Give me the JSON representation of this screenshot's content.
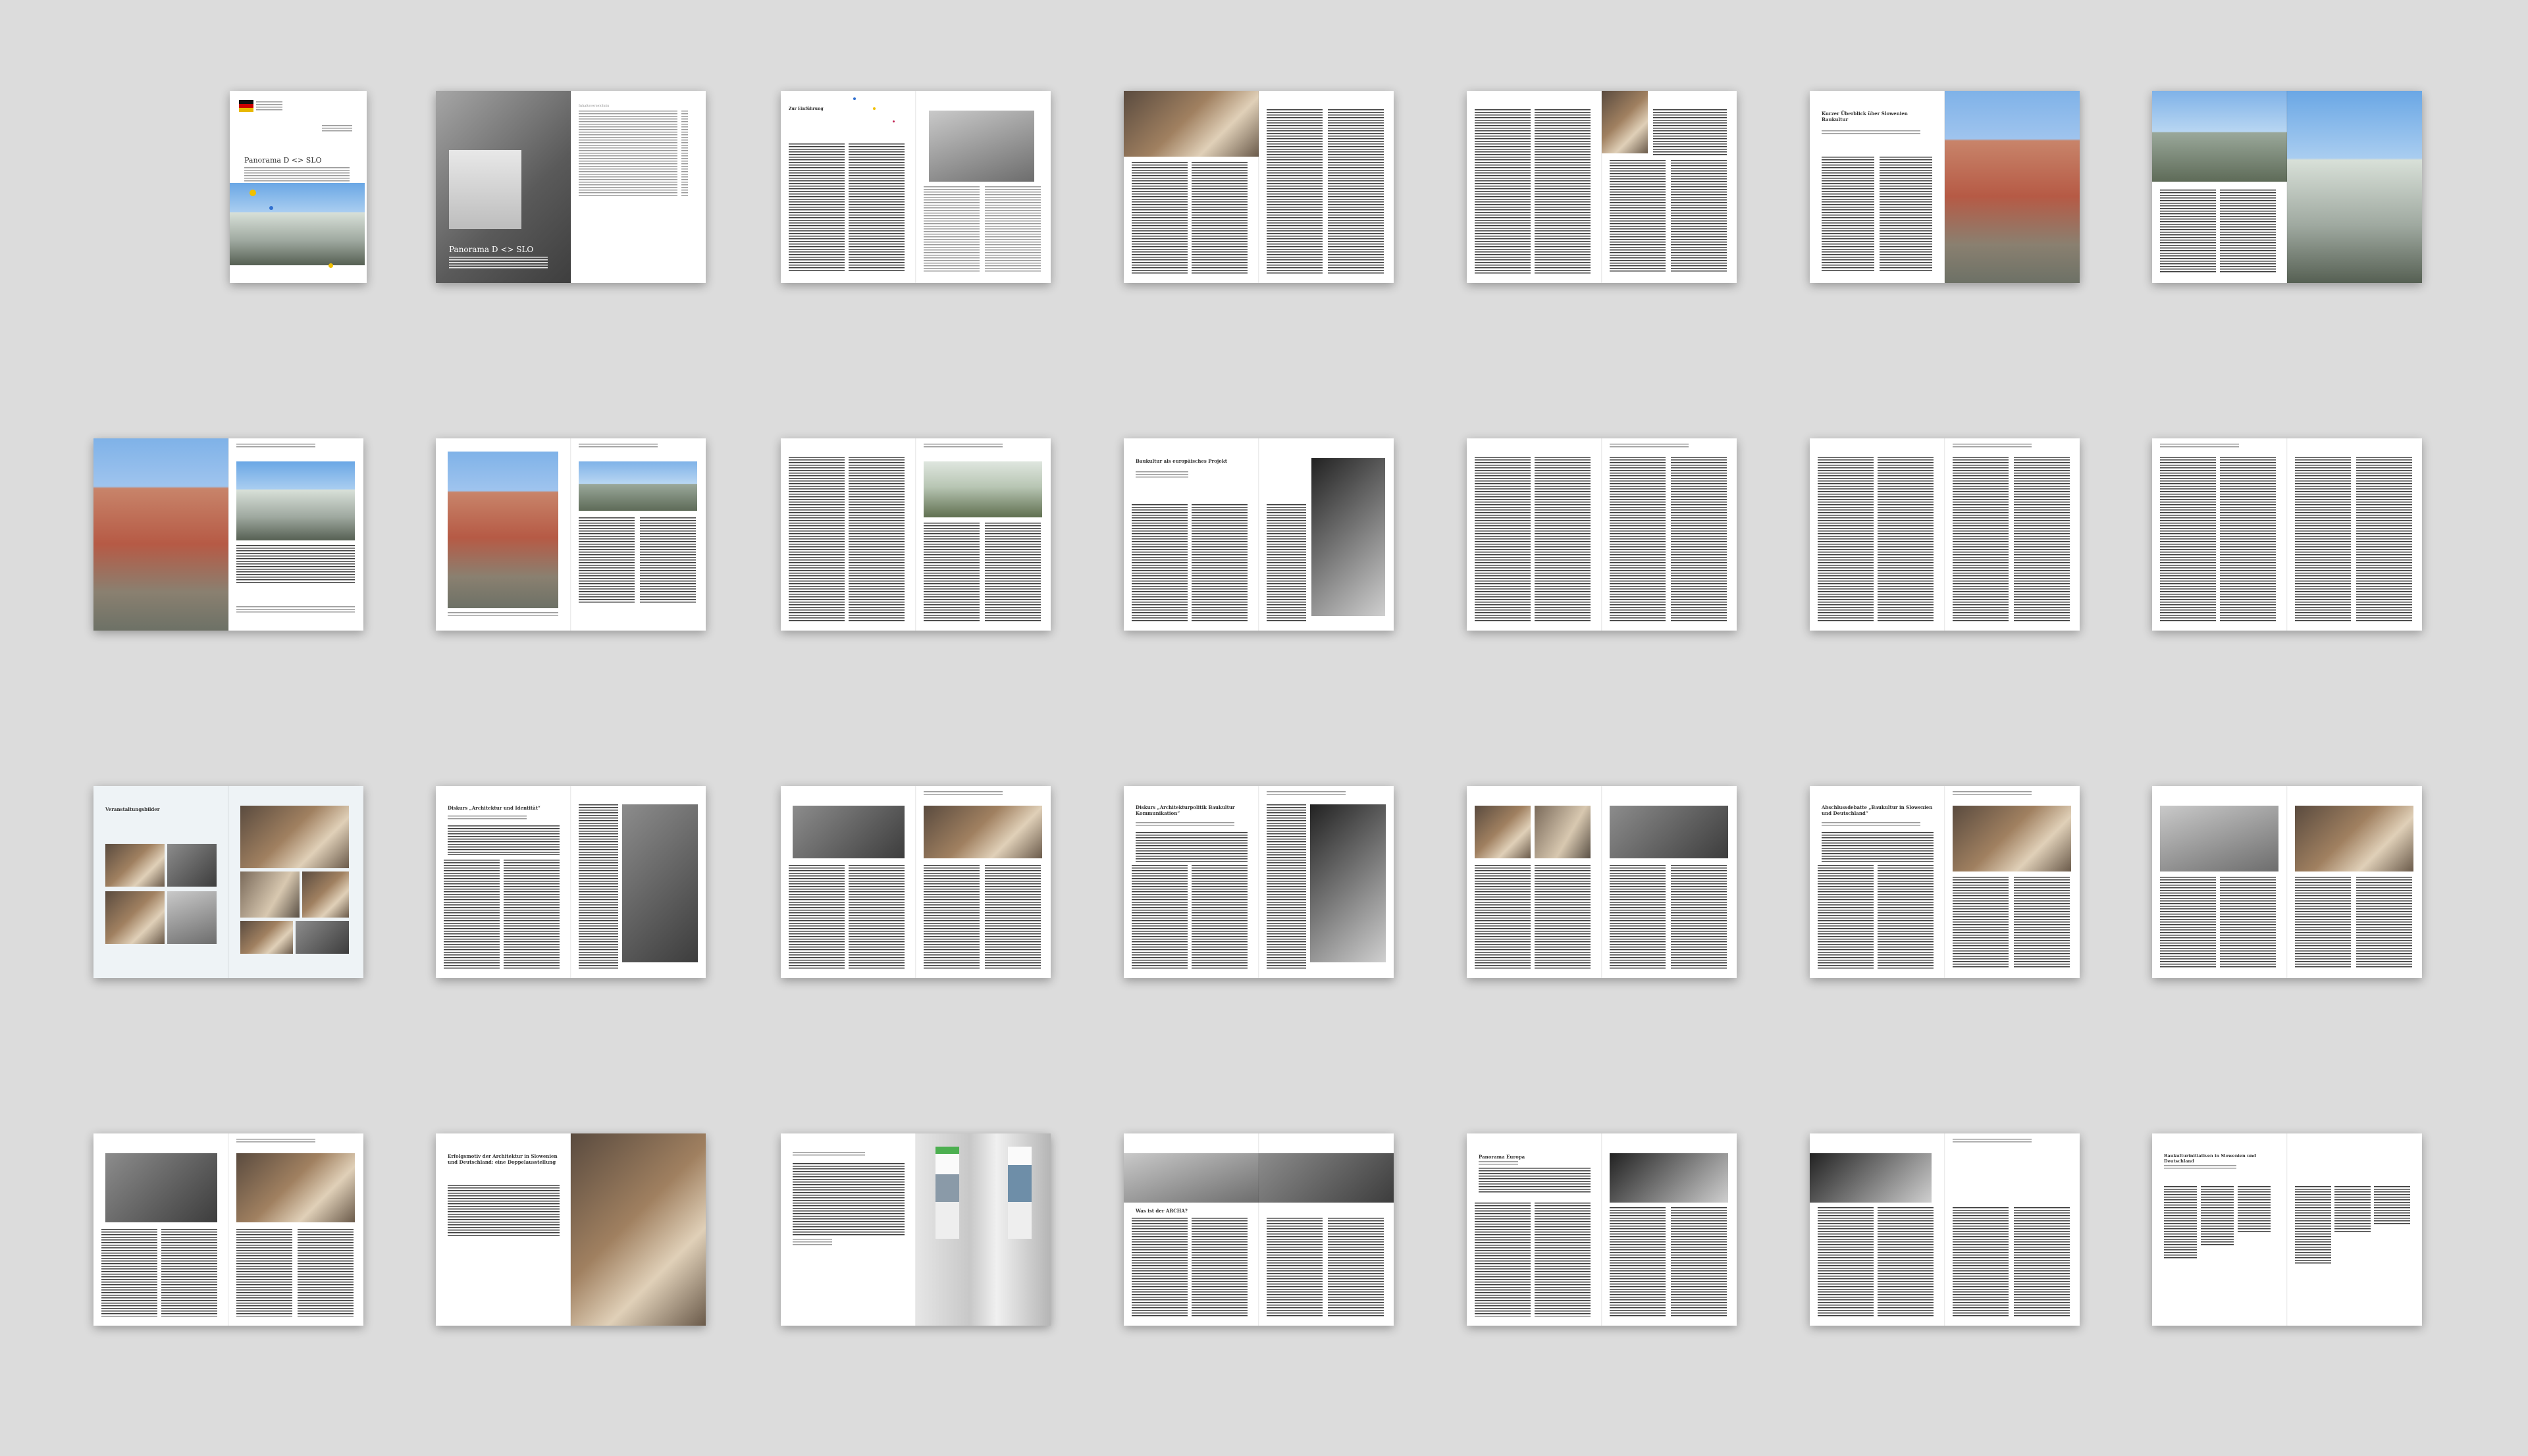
{
  "colors": {
    "background": "#dcdcdc",
    "page": "#ffffff",
    "text": "#333333"
  },
  "spreads": [
    {
      "id": 1,
      "title": "Panorama D <> SLO",
      "toc_title": "",
      "heading": "",
      "heading2": ""
    },
    {
      "id": 2,
      "title": "Panorama D <> SLO",
      "toc_title": "Inhaltsverzeichnis",
      "heading": "",
      "heading2": ""
    },
    {
      "id": 3,
      "title": "",
      "toc_title": "",
      "heading": "Zur Einführung",
      "heading2": ""
    },
    {
      "id": 4,
      "heading": "",
      "heading2": ""
    },
    {
      "id": 5,
      "heading": "",
      "heading2": ""
    },
    {
      "id": 6,
      "heading": "Kurzer Überblick über Slowenien Baukultur",
      "heading2": ""
    },
    {
      "id": 7,
      "heading": "",
      "heading2": ""
    },
    {
      "id": 8,
      "heading": "",
      "heading2": ""
    },
    {
      "id": 9,
      "heading": "",
      "heading2": ""
    },
    {
      "id": 10,
      "heading": "",
      "heading2": ""
    },
    {
      "id": 11,
      "heading": "Baukultur als europäisches Projekt",
      "heading2": ""
    },
    {
      "id": 12,
      "heading": "",
      "heading2": ""
    },
    {
      "id": 13,
      "heading": "",
      "heading2": ""
    },
    {
      "id": 14,
      "heading": "",
      "heading2": ""
    },
    {
      "id": 15,
      "heading": "Veranstaltungsbilder",
      "heading2": ""
    },
    {
      "id": 16,
      "heading": "Diskurs „Architektur und Identität“",
      "heading2": ""
    },
    {
      "id": 17,
      "heading": "",
      "heading2": ""
    },
    {
      "id": 18,
      "heading": "Diskurs „Architekturpolitik Baukultur Kommunikation“",
      "heading2": ""
    },
    {
      "id": 19,
      "heading": "",
      "heading2": ""
    },
    {
      "id": 20,
      "heading": "Abschlussdebatte „Baukultur in Slowenien und Deutschland“",
      "heading2": ""
    },
    {
      "id": 21,
      "heading": "",
      "heading2": ""
    },
    {
      "id": 22,
      "heading": "",
      "heading2": ""
    },
    {
      "id": 23,
      "heading": "Erfolgsmotiv der Architektur in Slowenien und Deutschland: eine Doppelausstellung",
      "heading2": ""
    },
    {
      "id": 24,
      "heading": "",
      "heading2": ""
    },
    {
      "id": 25,
      "heading": "Was ist der ARCHA?",
      "heading2": ""
    },
    {
      "id": 26,
      "heading": "Panorama Europa",
      "heading2": ""
    },
    {
      "id": 27,
      "heading": "",
      "heading2": ""
    },
    {
      "id": 28,
      "heading": "Baukulturinitiativen in Slowenien und Deutschland",
      "heading2": ""
    }
  ]
}
